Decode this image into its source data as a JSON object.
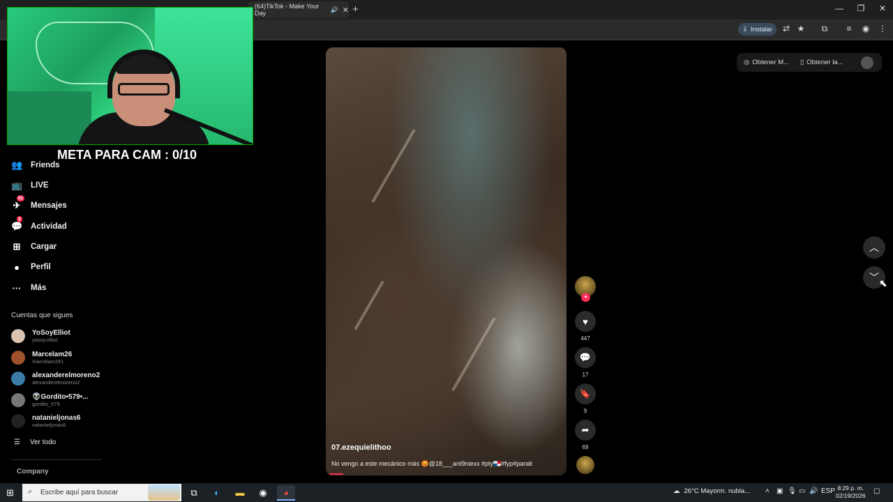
{
  "browser": {
    "tab_title": "(64)TikTok - Make Your Day",
    "new_tab": "+",
    "install_label": "Instalar",
    "window_controls": [
      "—",
      "❐",
      "✕"
    ]
  },
  "overlay": {
    "meta_text": "META PARA CAM : 0/10"
  },
  "sidebar": {
    "items": [
      {
        "label": "Friends",
        "icon": "friends-icon",
        "glyph": "👥"
      },
      {
        "label": "LIVE",
        "icon": "live-icon",
        "glyph": "📺"
      },
      {
        "label": "Mensajes",
        "icon": "messages-icon",
        "glyph": "✈",
        "badge": "61"
      },
      {
        "label": "Actividad",
        "icon": "activity-icon",
        "glyph": "💬",
        "badge": "3"
      },
      {
        "label": "Cargar",
        "icon": "upload-icon",
        "glyph": "⊞"
      },
      {
        "label": "Perfil",
        "icon": "profile-icon",
        "glyph": "●"
      },
      {
        "label": "Más",
        "icon": "more-icon",
        "glyph": "···"
      }
    ],
    "following_title": "Cuentas que sigues",
    "accounts": [
      {
        "name": "YoSoyElliot",
        "handle": "yosoy.elliot",
        "color": "#d9c2b0"
      },
      {
        "name": "Marcelam26",
        "handle": "marcelam261",
        "color": "#a0522d"
      },
      {
        "name": "alexanderelmoreno2",
        "handle": "alexanderelmoreno2",
        "color": "#3a7ca5"
      },
      {
        "name": "👽Gordito•579•...",
        "handle": "gordito_579",
        "color": "#777"
      },
      {
        "name": "natanieljonas6",
        "handle": "natanieljonas6",
        "color": "#222"
      }
    ],
    "see_all": "Ver todo",
    "company": "Company"
  },
  "video": {
    "username": "07.ezequielithoo",
    "caption": "No vengo a este mecánico más 😡@18___ant9niexx #pty🇵🇦#fyp#parati",
    "progress": 0.06
  },
  "actions": {
    "likes": "447",
    "comments": "17",
    "saves": "9",
    "shares": "69"
  },
  "top_right": {
    "item1": "Obtener M...",
    "item2": "Obtener la..."
  },
  "taskbar": {
    "search_placeholder": "Escribe aquí para buscar",
    "weather": "26°C  Mayorm. nubla...",
    "lang": "ESP",
    "time": "8:29 p. m.",
    "date": "02/19/2026"
  }
}
